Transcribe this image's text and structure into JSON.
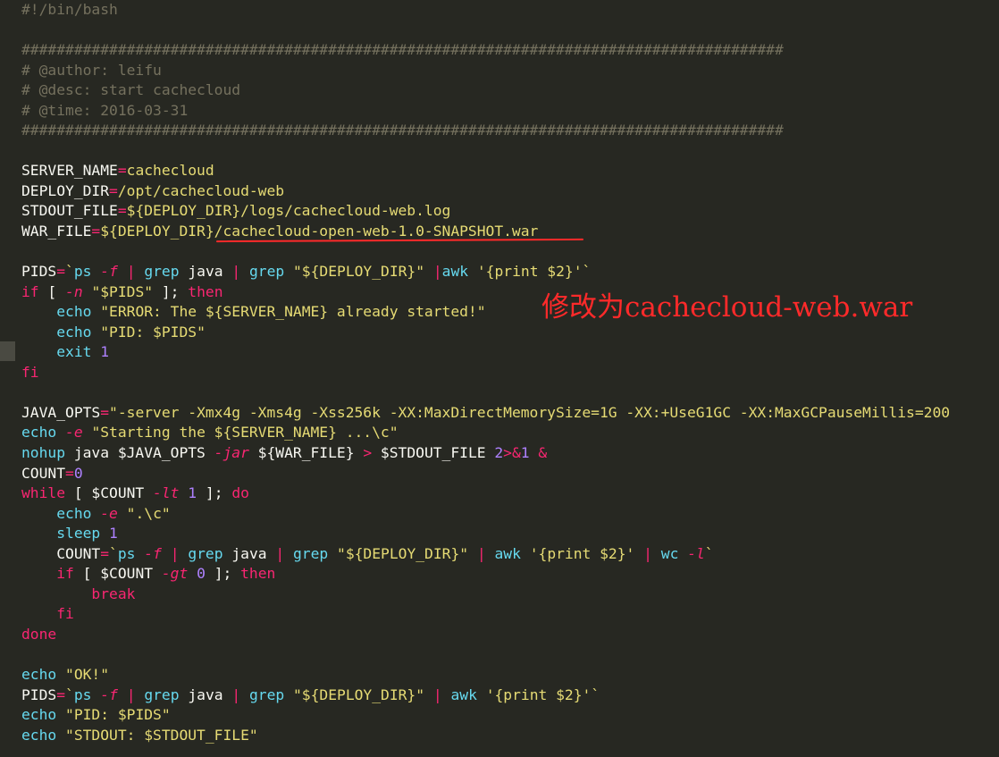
{
  "editor": {
    "background": "#272822",
    "palette": {
      "comment": "#75715e",
      "keyword": "#f92672",
      "builtin": "#66d9ef",
      "string": "#e6db74",
      "number": "#ae81ff",
      "text": "#f8f8f2"
    },
    "lines": [
      [
        {
          "t": "#!/bin/bash",
          "c": "c"
        }
      ],
      [],
      [
        {
          "t": "#######################################################################################",
          "c": "c"
        }
      ],
      [
        {
          "t": "# @author: leifu",
          "c": "c"
        }
      ],
      [
        {
          "t": "# @desc: start cachecloud",
          "c": "c"
        }
      ],
      [
        {
          "t": "# @time: 2016-03-31",
          "c": "c"
        }
      ],
      [
        {
          "t": "#######################################################################################",
          "c": "c"
        }
      ],
      [],
      [
        {
          "t": "SERVER_NAME",
          "c": "w"
        },
        {
          "t": "=",
          "c": "k"
        },
        {
          "t": "cachecloud",
          "c": "s"
        }
      ],
      [
        {
          "t": "DEPLOY_DIR",
          "c": "w"
        },
        {
          "t": "=",
          "c": "k"
        },
        {
          "t": "/opt/cachecloud-web",
          "c": "s"
        }
      ],
      [
        {
          "t": "STDOUT_FILE",
          "c": "w"
        },
        {
          "t": "=",
          "c": "k"
        },
        {
          "t": "${DEPLOY_DIR}/logs/cachecloud-web.log",
          "c": "s"
        }
      ],
      [
        {
          "t": "WAR_FILE",
          "c": "w"
        },
        {
          "t": "=",
          "c": "k"
        },
        {
          "t": "${DEPLOY_DIR}/cachecloud-open-web-1.0-SNAPSHOT.war",
          "c": "s"
        }
      ],
      [],
      [
        {
          "t": "PIDS",
          "c": "w"
        },
        {
          "t": "=",
          "c": "k"
        },
        {
          "t": "`",
          "c": "s"
        },
        {
          "t": "ps",
          "c": "b"
        },
        {
          "t": " ",
          "c": "w"
        },
        {
          "t": "-f",
          "c": "i"
        },
        {
          "t": " ",
          "c": "w"
        },
        {
          "t": "|",
          "c": "k"
        },
        {
          "t": " ",
          "c": "w"
        },
        {
          "t": "grep",
          "c": "b"
        },
        {
          "t": " java ",
          "c": "w"
        },
        {
          "t": "|",
          "c": "k"
        },
        {
          "t": " ",
          "c": "w"
        },
        {
          "t": "grep",
          "c": "b"
        },
        {
          "t": " \"${DEPLOY_DIR}\" ",
          "c": "s"
        },
        {
          "t": "|",
          "c": "k"
        },
        {
          "t": "awk",
          "c": "b"
        },
        {
          "t": " '{print $2}'`",
          "c": "s"
        }
      ],
      [
        {
          "t": "if",
          "c": "k"
        },
        {
          "t": " [ ",
          "c": "w"
        },
        {
          "t": "-n",
          "c": "i"
        },
        {
          "t": " \"$PIDS\"",
          "c": "s"
        },
        {
          "t": " ]; ",
          "c": "w"
        },
        {
          "t": "then",
          "c": "k"
        }
      ],
      [
        {
          "t": "    ",
          "c": "w"
        },
        {
          "t": "echo",
          "c": "b"
        },
        {
          "t": " \"ERROR: The ${SERVER_NAME} already started!\"",
          "c": "s"
        }
      ],
      [
        {
          "t": "    ",
          "c": "w"
        },
        {
          "t": "echo",
          "c": "b"
        },
        {
          "t": " \"PID: $PIDS\"",
          "c": "s"
        }
      ],
      [
        {
          "t": "    ",
          "c": "w"
        },
        {
          "t": "exit",
          "c": "b"
        },
        {
          "t": " ",
          "c": "w"
        },
        {
          "t": "1",
          "c": "n"
        }
      ],
      [
        {
          "t": "fi",
          "c": "k"
        }
      ],
      [],
      [
        {
          "t": "JAVA_OPTS",
          "c": "w"
        },
        {
          "t": "=",
          "c": "k"
        },
        {
          "t": "\"-server -Xmx4g -Xms4g -Xss256k -XX:MaxDirectMemorySize=1G -XX:+UseG1GC -XX:MaxGCPauseMillis=200",
          "c": "s"
        }
      ],
      [
        {
          "t": "echo",
          "c": "b"
        },
        {
          "t": " ",
          "c": "w"
        },
        {
          "t": "-e",
          "c": "i"
        },
        {
          "t": " \"Starting the ${SERVER_NAME} ...\\c\"",
          "c": "s"
        }
      ],
      [
        {
          "t": "nohup",
          "c": "b"
        },
        {
          "t": " java $JAVA_OPTS ",
          "c": "w"
        },
        {
          "t": "-jar",
          "c": "i"
        },
        {
          "t": " ${WAR_FILE} ",
          "c": "w"
        },
        {
          "t": ">",
          "c": "k"
        },
        {
          "t": " $STDOUT_FILE ",
          "c": "w"
        },
        {
          "t": "2",
          "c": "n"
        },
        {
          "t": ">&",
          "c": "k"
        },
        {
          "t": "1",
          "c": "n"
        },
        {
          "t": " ",
          "c": "w"
        },
        {
          "t": "&",
          "c": "k"
        }
      ],
      [
        {
          "t": "COUNT",
          "c": "w"
        },
        {
          "t": "=",
          "c": "k"
        },
        {
          "t": "0",
          "c": "n"
        }
      ],
      [
        {
          "t": "while",
          "c": "k"
        },
        {
          "t": " [ $COUNT ",
          "c": "w"
        },
        {
          "t": "-lt",
          "c": "i"
        },
        {
          "t": " ",
          "c": "w"
        },
        {
          "t": "1",
          "c": "n"
        },
        {
          "t": " ]; ",
          "c": "w"
        },
        {
          "t": "do",
          "c": "k"
        }
      ],
      [
        {
          "t": "    ",
          "c": "w"
        },
        {
          "t": "echo",
          "c": "b"
        },
        {
          "t": " ",
          "c": "w"
        },
        {
          "t": "-e",
          "c": "i"
        },
        {
          "t": " \".\\c\"",
          "c": "s"
        }
      ],
      [
        {
          "t": "    ",
          "c": "w"
        },
        {
          "t": "sleep",
          "c": "b"
        },
        {
          "t": " ",
          "c": "w"
        },
        {
          "t": "1",
          "c": "n"
        }
      ],
      [
        {
          "t": "    COUNT",
          "c": "w"
        },
        {
          "t": "=",
          "c": "k"
        },
        {
          "t": "`",
          "c": "s"
        },
        {
          "t": "ps",
          "c": "b"
        },
        {
          "t": " ",
          "c": "w"
        },
        {
          "t": "-f",
          "c": "i"
        },
        {
          "t": " ",
          "c": "w"
        },
        {
          "t": "|",
          "c": "k"
        },
        {
          "t": " ",
          "c": "w"
        },
        {
          "t": "grep",
          "c": "b"
        },
        {
          "t": " java ",
          "c": "w"
        },
        {
          "t": "|",
          "c": "k"
        },
        {
          "t": " ",
          "c": "w"
        },
        {
          "t": "grep",
          "c": "b"
        },
        {
          "t": " \"${DEPLOY_DIR}\" ",
          "c": "s"
        },
        {
          "t": "|",
          "c": "k"
        },
        {
          "t": " ",
          "c": "w"
        },
        {
          "t": "awk",
          "c": "b"
        },
        {
          "t": " '{print $2}' ",
          "c": "s"
        },
        {
          "t": "|",
          "c": "k"
        },
        {
          "t": " ",
          "c": "w"
        },
        {
          "t": "wc",
          "c": "b"
        },
        {
          "t": " ",
          "c": "w"
        },
        {
          "t": "-l",
          "c": "i"
        },
        {
          "t": "`",
          "c": "s"
        }
      ],
      [
        {
          "t": "    ",
          "c": "w"
        },
        {
          "t": "if",
          "c": "k"
        },
        {
          "t": " [ $COUNT ",
          "c": "w"
        },
        {
          "t": "-gt",
          "c": "i"
        },
        {
          "t": " ",
          "c": "w"
        },
        {
          "t": "0",
          "c": "n"
        },
        {
          "t": " ]; ",
          "c": "w"
        },
        {
          "t": "then",
          "c": "k"
        }
      ],
      [
        {
          "t": "        ",
          "c": "w"
        },
        {
          "t": "break",
          "c": "k"
        }
      ],
      [
        {
          "t": "    ",
          "c": "w"
        },
        {
          "t": "fi",
          "c": "k"
        }
      ],
      [
        {
          "t": "done",
          "c": "k"
        }
      ],
      [],
      [
        {
          "t": "echo",
          "c": "b"
        },
        {
          "t": " \"OK!\"",
          "c": "s"
        }
      ],
      [
        {
          "t": "PIDS",
          "c": "w"
        },
        {
          "t": "=",
          "c": "k"
        },
        {
          "t": "`",
          "c": "s"
        },
        {
          "t": "ps",
          "c": "b"
        },
        {
          "t": " ",
          "c": "w"
        },
        {
          "t": "-f",
          "c": "i"
        },
        {
          "t": " ",
          "c": "w"
        },
        {
          "t": "|",
          "c": "k"
        },
        {
          "t": " ",
          "c": "w"
        },
        {
          "t": "grep",
          "c": "b"
        },
        {
          "t": " java ",
          "c": "w"
        },
        {
          "t": "|",
          "c": "k"
        },
        {
          "t": " ",
          "c": "w"
        },
        {
          "t": "grep",
          "c": "b"
        },
        {
          "t": " \"${DEPLOY_DIR}\" ",
          "c": "s"
        },
        {
          "t": "|",
          "c": "k"
        },
        {
          "t": " ",
          "c": "w"
        },
        {
          "t": "awk",
          "c": "b"
        },
        {
          "t": " '{print $2}'`",
          "c": "s"
        }
      ],
      [
        {
          "t": "echo",
          "c": "b"
        },
        {
          "t": " \"PID: $PIDS\"",
          "c": "s"
        }
      ],
      [
        {
          "t": "echo",
          "c": "b"
        },
        {
          "t": " \"STDOUT: $STDOUT_FILE\"",
          "c": "s"
        }
      ]
    ]
  },
  "annotation": {
    "text": "修改为cachecloud-web.war",
    "color": "#ff2a2a"
  }
}
